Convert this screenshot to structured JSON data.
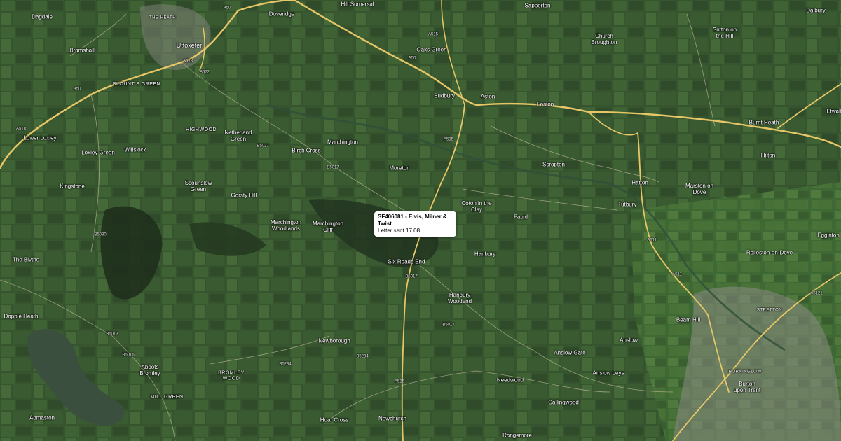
{
  "map": {
    "place_labels": [
      {
        "text": "Dagdale"
      },
      {
        "text": "THE HEATH"
      },
      {
        "text": "Doveridge"
      },
      {
        "text": "Hill Somersal"
      },
      {
        "text": "Sapperton"
      },
      {
        "text": "Dalbury"
      },
      {
        "text": "Uttoxeter"
      },
      {
        "text": "Bramshall"
      },
      {
        "text": "Oaks Green"
      },
      {
        "text": "Church Broughton"
      },
      {
        "text": "Sutton on the Hill"
      },
      {
        "text": "BLOUNT'S GREEN"
      },
      {
        "text": "Sudbury"
      },
      {
        "text": "Aston"
      },
      {
        "text": "Foston"
      },
      {
        "text": "Burnt Heath"
      },
      {
        "text": "Etwall"
      },
      {
        "text": "HIGHWOOD"
      },
      {
        "text": "Netherland Green"
      },
      {
        "text": "Lower Loxley"
      },
      {
        "text": "Marchington"
      },
      {
        "text": "Birch Cross"
      },
      {
        "text": "Willslock"
      },
      {
        "text": "Loxley Green"
      },
      {
        "text": "Moreton"
      },
      {
        "text": "Scropton"
      },
      {
        "text": "Hilton"
      },
      {
        "text": "Hatton"
      },
      {
        "text": "Kingstone"
      },
      {
        "text": "Scounslow Green"
      },
      {
        "text": "Gorsty Hill"
      },
      {
        "text": "Marston on Dove"
      },
      {
        "text": "Coton in the Clay"
      },
      {
        "text": "Fauld"
      },
      {
        "text": "Tutbury"
      },
      {
        "text": "Marchington Woodlands"
      },
      {
        "text": "Marchington Cliff"
      },
      {
        "text": "in the Clay"
      },
      {
        "text": "Hanbury"
      },
      {
        "text": "Rolleston-on-Dove"
      },
      {
        "text": "Egginton"
      },
      {
        "text": "The Blythe"
      },
      {
        "text": "Six Roads End"
      },
      {
        "text": "Hanbury Woodend"
      },
      {
        "text": "STRETTON"
      },
      {
        "text": "Beam Hill"
      },
      {
        "text": "Dapple Heath"
      },
      {
        "text": "Newborough"
      },
      {
        "text": "Anslow"
      },
      {
        "text": "Anslow Gate"
      },
      {
        "text": "Abbots Bromley"
      },
      {
        "text": "BROMLEY WOOD"
      },
      {
        "text": "Needwood"
      },
      {
        "text": "Anslow Leys"
      },
      {
        "text": "HORNINGLOW"
      },
      {
        "text": "MILL GREEN"
      },
      {
        "text": "Callingwood"
      },
      {
        "text": "Burton upon Trent"
      },
      {
        "text": "Admaston"
      },
      {
        "text": "Hoar Cross"
      },
      {
        "text": "Newchurch"
      },
      {
        "text": "Rangemore"
      }
    ],
    "road_labels": [
      {
        "text": "A50"
      },
      {
        "text": "A50"
      },
      {
        "text": "A515"
      },
      {
        "text": "A518"
      },
      {
        "text": "A518"
      },
      {
        "text": "B5027"
      },
      {
        "text": "A522"
      },
      {
        "text": "B5017"
      },
      {
        "text": "B5017"
      },
      {
        "text": "B5030"
      },
      {
        "text": "A50"
      },
      {
        "text": "A515"
      },
      {
        "text": "A515"
      },
      {
        "text": "A511"
      },
      {
        "text": "B5234"
      },
      {
        "text": "B5017"
      },
      {
        "text": "B5016"
      },
      {
        "text": "B5013"
      },
      {
        "text": "A511"
      },
      {
        "text": "A5121"
      },
      {
        "text": "B5234"
      }
    ],
    "popup": {
      "title": "SF406081 - Elvis, Milner & Twist",
      "line": "Letter sent 17.08"
    }
  }
}
